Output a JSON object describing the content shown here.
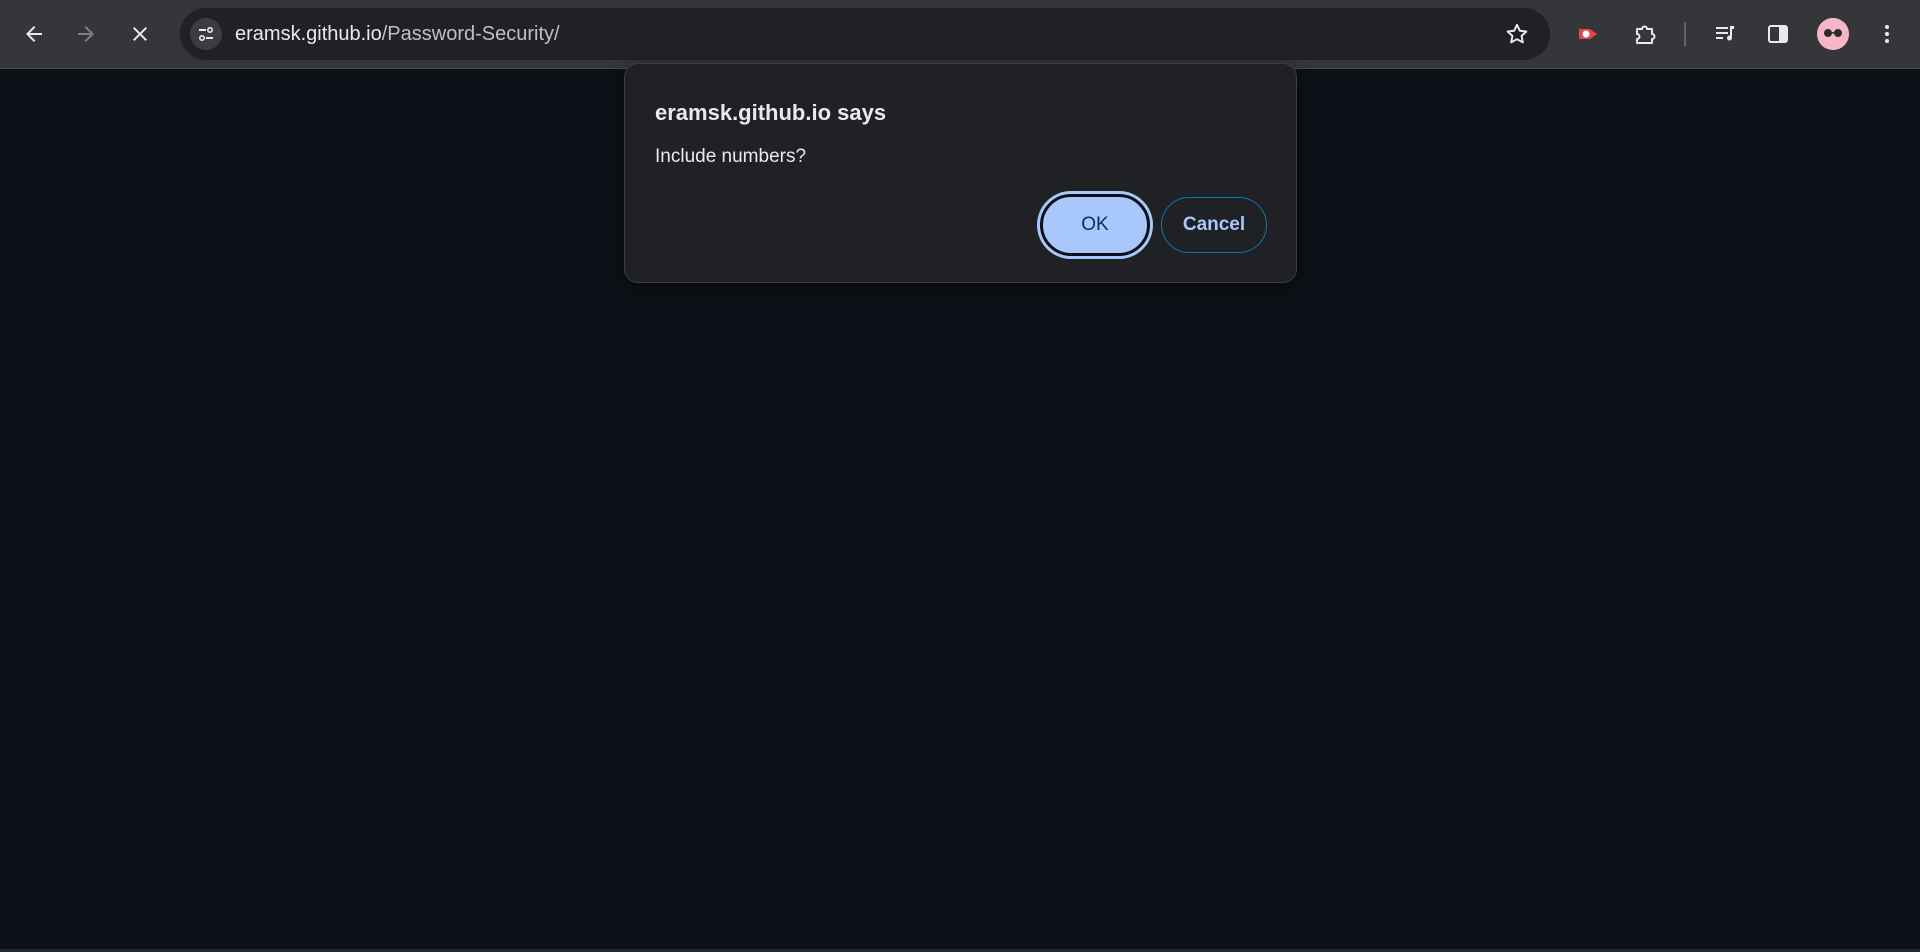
{
  "browser": {
    "url_host": "eramsk.github.io",
    "url_path": "/Password-Security/",
    "icons": {
      "back": "arrow-left-icon",
      "forward": "arrow-right-icon",
      "stop": "close-icon",
      "site_info": "tune-icon",
      "bookmark": "star-icon",
      "extension_1": "video-record-extension-icon",
      "extensions": "puzzle-icon",
      "media": "media-queue-icon",
      "side_panel": "side-panel-icon",
      "profile": "avatar",
      "menu": "more-vert-icon"
    }
  },
  "dialog": {
    "title": "eramsk.github.io says",
    "message": "Include numbers?",
    "ok_label": "OK",
    "cancel_label": "Cancel"
  },
  "colors": {
    "page_background": "#0d1117",
    "toolbar": "#35363a",
    "dialog_background": "#202124",
    "primary_button": "#a8c7fa"
  }
}
